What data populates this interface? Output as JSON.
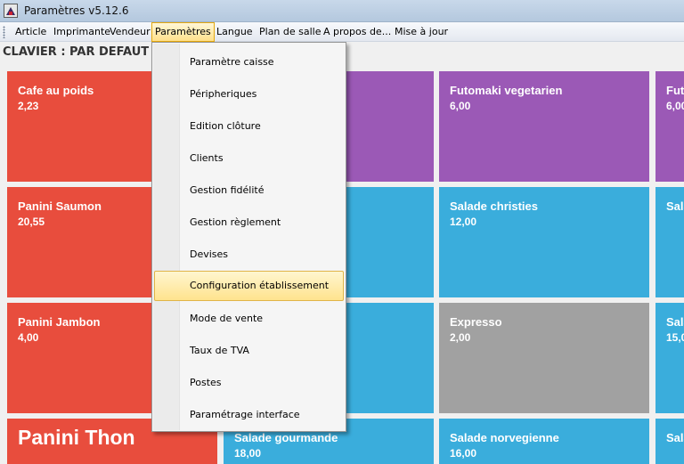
{
  "window": {
    "title": "Paramètres v5.12.6",
    "icon": "app-logo-icon"
  },
  "menubar": {
    "items": [
      "Article",
      "Imprimante",
      "Vendeur",
      "Paramètres",
      "Langue",
      "Plan de salle",
      "A propos de...",
      "Mise à jour"
    ],
    "active": "Paramètres"
  },
  "keyboard": {
    "title": "CLAVIER : PAR DEFAUT"
  },
  "tiles": [
    {
      "name": "Cafe au poids",
      "price": "2,23"
    },
    {
      "name": "Futomaki vegetarien",
      "price": "6,00"
    },
    {
      "name": "Futo",
      "price": "6,00"
    },
    {
      "name": "Panini Saumon",
      "price": "20,55"
    },
    {
      "name": "Salade christies",
      "price": "12,00"
    },
    {
      "name": "Sala",
      "price": ""
    },
    {
      "name": "Panini Jambon",
      "price": "4,00"
    },
    {
      "name": "Expresso",
      "price": "2,00"
    },
    {
      "name": "Sala",
      "price": "15,0"
    },
    {
      "name": "Panini Thon",
      "price": ""
    },
    {
      "name": "Salade gourmande",
      "price": "18,00"
    },
    {
      "name": "Salade norvegienne",
      "price": "16,00"
    },
    {
      "name": "Sala",
      "price": ""
    }
  ],
  "dropdown": {
    "items": [
      "Paramètre caisse",
      "Péripheriques",
      "Edition clôture",
      "Clients",
      "Gestion fidélité",
      "Gestion règlement",
      "Devises",
      "Configuration établissement",
      "Mode de vente",
      "Taux de TVA",
      "Postes",
      "Paramétrage interface"
    ],
    "highlighted": "Configuration établissement"
  },
  "colors": {
    "red": "#e84d3d",
    "purple": "#9b59b6",
    "blue": "#3aaddc",
    "gray": "#a1a1a1",
    "menu_highlight": "#ffe38e"
  }
}
